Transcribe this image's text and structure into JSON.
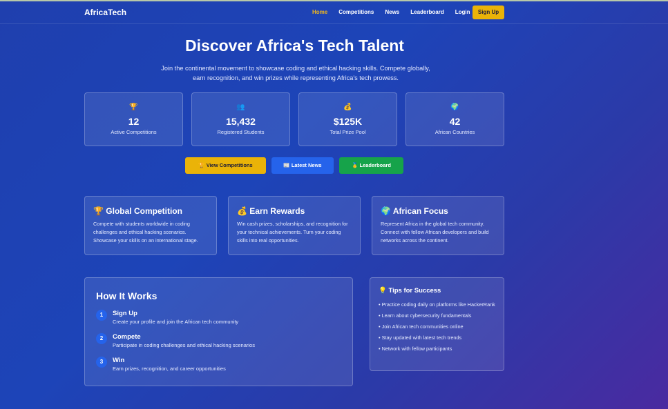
{
  "nav": {
    "brand": "AfricaTech",
    "links": [
      "Home",
      "Competitions",
      "News",
      "Leaderboard",
      "Login"
    ],
    "signup": "Sign Up"
  },
  "hero": {
    "title": "Discover Africa's Tech Talent",
    "subtitle": "Join the continental movement to showcase coding and ethical hacking skills. Compete globally, earn recognition, and win prizes while representing Africa's tech prowess."
  },
  "stats": [
    {
      "icon": "🏆",
      "icon_name": "trophy-icon",
      "value": "12",
      "label": "Active Competitions"
    },
    {
      "icon": "👥",
      "icon_name": "users-icon",
      "value": "15,432",
      "label": "Registered Students"
    },
    {
      "icon": "💰",
      "icon_name": "money-bag-icon",
      "value": "$125K",
      "label": "Total Prize Pool"
    },
    {
      "icon": "🌍",
      "icon_name": "globe-icon",
      "value": "42",
      "label": "African Countries"
    }
  ],
  "cta": [
    {
      "label": "🏆 View Competitions",
      "color": "#eab308"
    },
    {
      "label": "📰 Latest News",
      "color": "#2563eb"
    },
    {
      "label": "🥇 Leaderboard",
      "color": "#16a34a"
    }
  ],
  "features": [
    {
      "title": "🏆 Global Competition",
      "text": "Compete with students worldwide in coding challenges and ethical hacking scenarios. Showcase your skills on an international stage."
    },
    {
      "title": "💰 Earn Rewards",
      "text": "Win cash prizes, scholarships, and recognition for your technical achievements. Turn your coding skills into real opportunities."
    },
    {
      "title": "🌍 African Focus",
      "text": "Represent Africa in the global tech community. Connect with fellow African developers and build networks across the continent."
    }
  ],
  "how": {
    "title": "How It Works",
    "steps": [
      {
        "num": "1",
        "title": "Sign Up",
        "desc": "Create your profile and join the African tech community"
      },
      {
        "num": "2",
        "title": "Compete",
        "desc": "Participate in coding challenges and ethical hacking scenarios"
      },
      {
        "num": "3",
        "title": "Win",
        "desc": "Earn prizes, recognition, and career opportunities"
      }
    ]
  },
  "tips": {
    "title": "💡 Tips for Success",
    "items": [
      "• Practice coding daily on platforms like HackerRank",
      "• Learn about cybersecurity fundamentals",
      "• Join African tech communities online",
      "• Stay updated with latest tech trends",
      "• Network with fellow participants"
    ]
  },
  "colors": {
    "accent": "#eab308",
    "active_link": "#f3b81a",
    "step_badge": "#2563eb"
  }
}
